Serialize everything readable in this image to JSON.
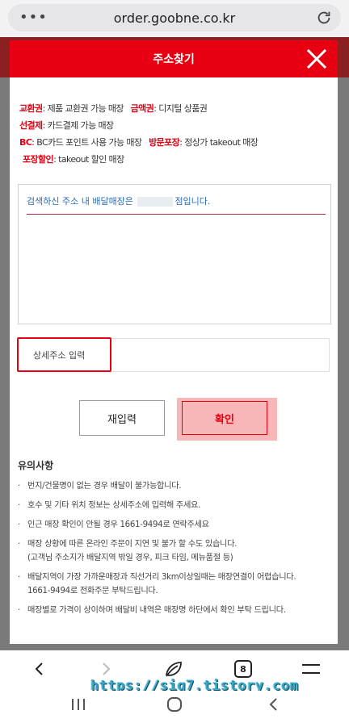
{
  "browser": {
    "url": "order.goobne.co.kr",
    "menu_dots": "•••",
    "tab_count": "8"
  },
  "modal": {
    "title": "주소찾기",
    "legend": [
      [
        {
          "k": "교환권",
          "v": "제품 교환권 가능 매장"
        },
        {
          "k": "금액권",
          "v": "디지털 상품권"
        }
      ],
      [
        {
          "k": "선결제",
          "v": "카드결제 가능 매장"
        }
      ],
      [
        {
          "k": "BC",
          "v": "BC카드 포인트 사용 가능 매장"
        },
        {
          "k": "방문포장",
          "v": "정상가 takeout 매장"
        }
      ],
      [
        {
          "k": "포장할인",
          "v": "takeout 할인 매장"
        }
      ]
    ],
    "result_prefix": "검색하신 주소 내 배달매장은",
    "result_suffix": "점입니다.",
    "detail_placeholder": "상세주소 입력",
    "reset_label": "재입력",
    "confirm_label": "확인",
    "notes_title": "유의사항",
    "notes": [
      "번지/건물명이 없는 경우 배달이 불가능합니다.",
      "호수 및 기타 위치 정보는 상세주소에 입력해 주세요.",
      "인근 매장 확인이 안될 경우 1661-9494로 연락주세요",
      "매장 상황에 따른 온라인 주문이 지연 및 불가 할 수도 있습니다.|(고객님 주소지가 배달지역 밖일 경우, 피크 타임, 메뉴품절 등)",
      "배달지역이 가장 가까운매장과 직선거리 3km이상일때는 매장연결이 어렵습니다.|1661-9494로 전화주문 부탁드립니다.",
      "매장별로 가격이 상이하며 배달비 내역은 매장명 하단에서 확인 부탁 드립니다."
    ]
  },
  "watermark": "https://sig7.tistory.com",
  "colors": {
    "brand_red": "#e60012",
    "confirm_bg": "#f7b6b7",
    "result_text": "#2a6db5"
  },
  "icons": {
    "close": "close-icon",
    "reload": "reload-icon",
    "back": "back-arrow-icon",
    "forward": "forward-arrow-icon",
    "home": "leaf-home-icon",
    "menu": "hamburger-menu-icon"
  }
}
